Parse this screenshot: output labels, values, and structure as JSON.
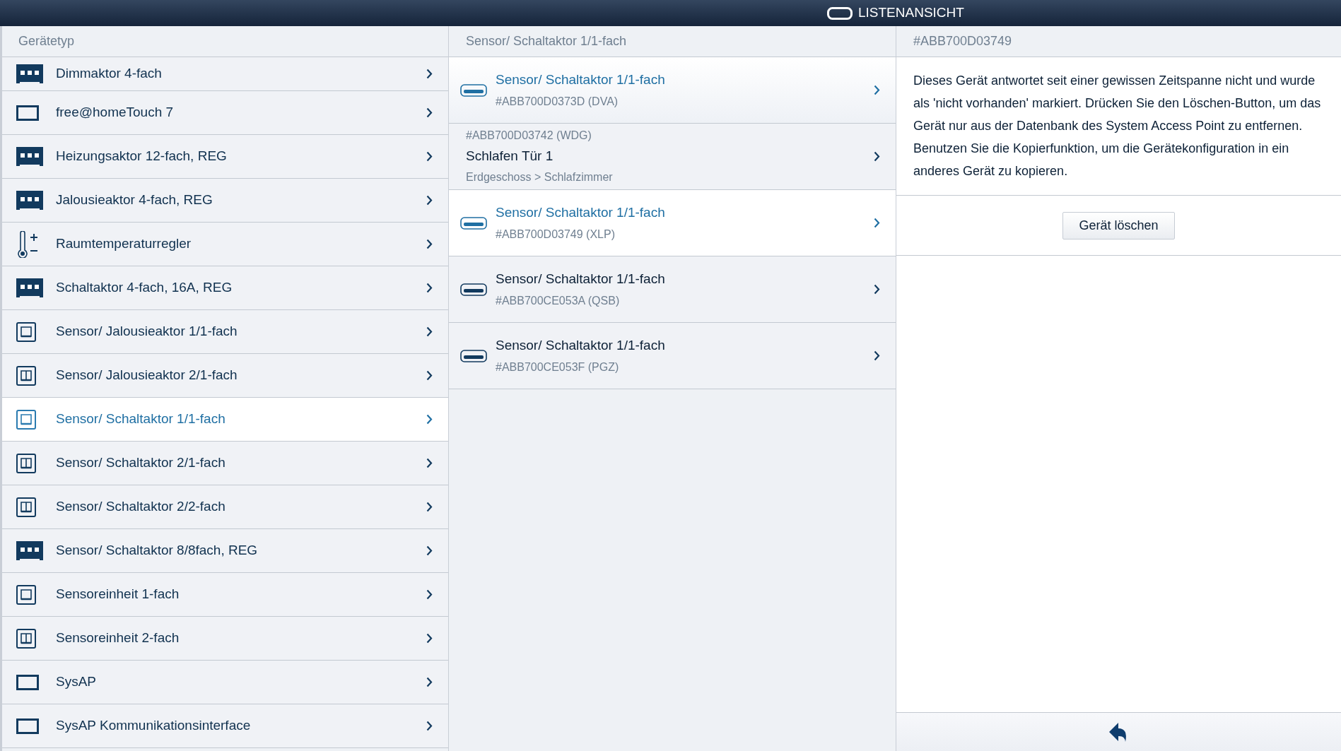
{
  "top_bar": {
    "title": "LISTENANSICHT"
  },
  "device_types": {
    "header": "Gerätetyp",
    "items": [
      {
        "label": "Dimmaktor 4-fach",
        "kind": "module",
        "selected": false
      },
      {
        "label": "free@homeTouch 7",
        "kind": "screen",
        "selected": false
      },
      {
        "label": "Heizungsaktor 12-fach, REG",
        "kind": "module",
        "selected": false
      },
      {
        "label": "Jalousieaktor 4-fach, REG",
        "kind": "module",
        "selected": false
      },
      {
        "label": "Raumtemperaturregler",
        "kind": "thermostat",
        "selected": false
      },
      {
        "label": "Schaltaktor 4-fach, 16A, REG",
        "kind": "module",
        "selected": false
      },
      {
        "label": "Sensor/ Jalousieaktor 1/1-fach",
        "kind": "single",
        "selected": false
      },
      {
        "label": "Sensor/ Jalousieaktor 2/1-fach",
        "kind": "double",
        "selected": false
      },
      {
        "label": "Sensor/ Schaltaktor 1/1-fach",
        "kind": "single",
        "selected": true
      },
      {
        "label": "Sensor/ Schaltaktor 2/1-fach",
        "kind": "double",
        "selected": false
      },
      {
        "label": "Sensor/ Schaltaktor 2/2-fach",
        "kind": "double",
        "selected": false
      },
      {
        "label": "Sensor/ Schaltaktor 8/8fach, REG",
        "kind": "module",
        "selected": false
      },
      {
        "label": "Sensoreinheit 1-fach",
        "kind": "single",
        "selected": false
      },
      {
        "label": "Sensoreinheit 2-fach",
        "kind": "double",
        "selected": false
      },
      {
        "label": "SysAP",
        "kind": "screen",
        "selected": false
      },
      {
        "label": "SysAP Kommunikationsinterface",
        "kind": "screen",
        "selected": false
      }
    ]
  },
  "devices": {
    "header": "Sensor/ Schaltaktor 1/1-fach",
    "items": [
      {
        "kind": "unnamed",
        "title": "Sensor/ Schaltaktor 1/1-fach",
        "serial": "#ABB700D0373D (DVA)",
        "highlighted": true,
        "selected": false
      },
      {
        "kind": "named",
        "serial": "#ABB700D03742 (WDG)",
        "title": "Schlafen Tür 1",
        "location": "Erdgeschoss > Schlafzimmer",
        "highlighted": false,
        "selected": false
      },
      {
        "kind": "unnamed",
        "title": "Sensor/ Schaltaktor 1/1-fach",
        "serial": "#ABB700D03749 (XLP)",
        "highlighted": false,
        "selected": true
      },
      {
        "kind": "unnamed",
        "title": "Sensor/ Schaltaktor 1/1-fach",
        "serial": "#ABB700CE053A (QSB)",
        "highlighted": false,
        "selected": false
      },
      {
        "kind": "unnamed",
        "title": "Sensor/ Schaltaktor 1/1-fach",
        "serial": "#ABB700CE053F (PGZ)",
        "highlighted": false,
        "selected": false
      }
    ]
  },
  "detail": {
    "header": "#ABB700D03749",
    "message": "Dieses Gerät antwortet seit einer gewissen Zeitspanne nicht und wurde als 'nicht vorhanden' markiert. Drücken Sie den Löschen-Button, um das Gerät nur aus der Datenbank des System Access Point zu entfernen. Benutzen Sie die Kopierfunktion, um die Gerätekonfiguration in ein anderes Gerät zu kopieren.",
    "delete_button": "Gerät löschen"
  }
}
